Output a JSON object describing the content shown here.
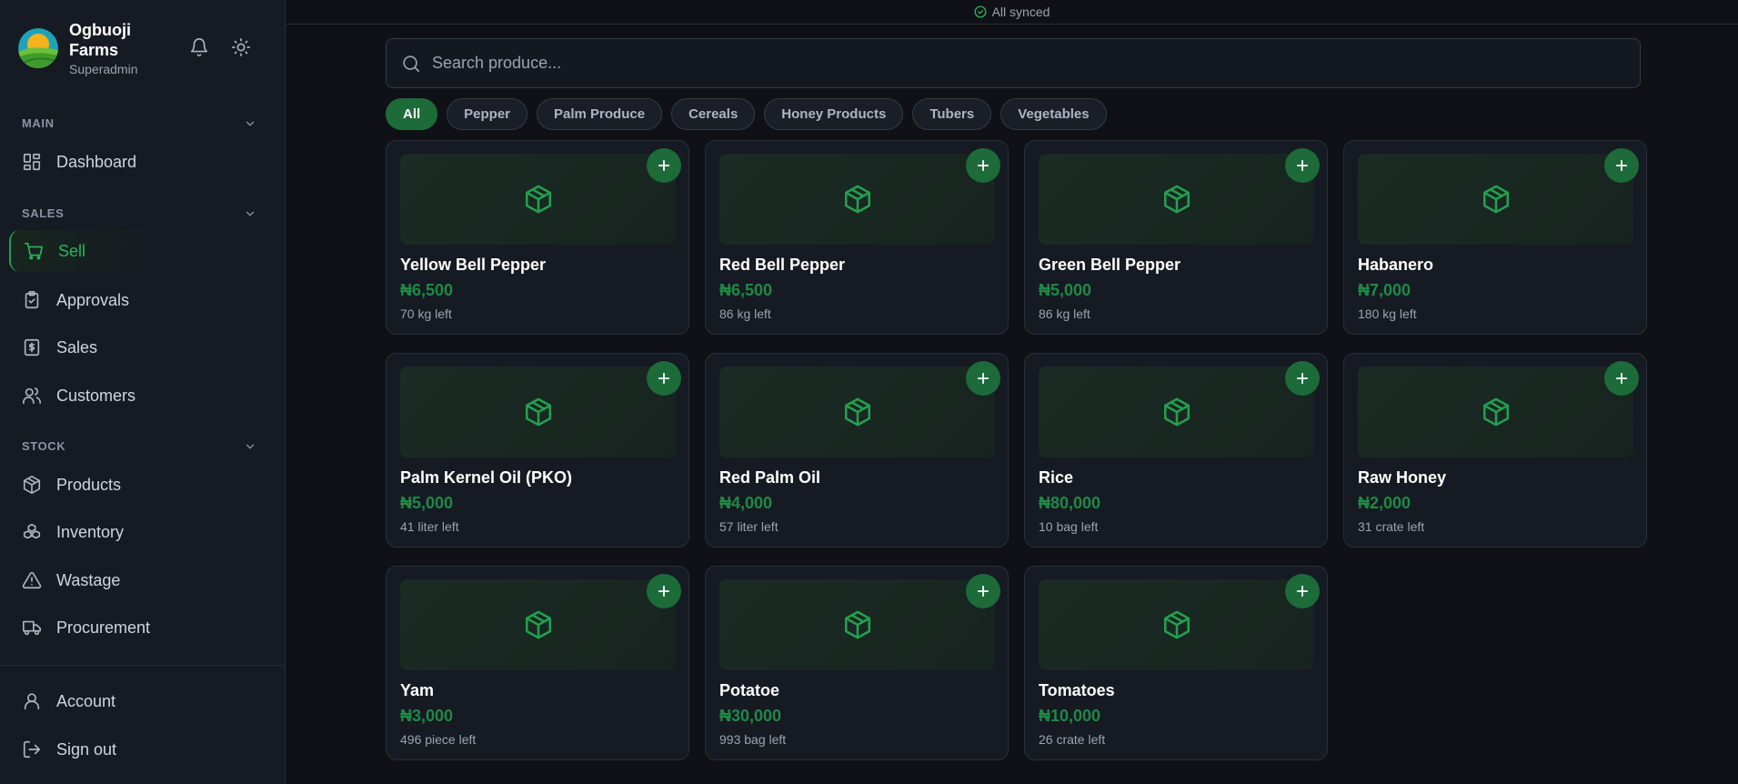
{
  "brand": {
    "name": "Ogbuoji Farms",
    "role": "Superadmin"
  },
  "icons": {
    "notifications": "bell-icon",
    "theme": "sun-icon"
  },
  "sidebar": {
    "sections": [
      {
        "label": "MAIN"
      },
      {
        "label": "SALES"
      },
      {
        "label": "STOCK"
      }
    ],
    "items": [
      {
        "label": "Dashboard",
        "icon": "dashboard-icon"
      },
      {
        "label": "Sell",
        "icon": "cart-icon",
        "active": true
      },
      {
        "label": "Approvals",
        "icon": "clipboard-check-icon"
      },
      {
        "label": "Sales",
        "icon": "receipt-dollar-icon"
      },
      {
        "label": "Customers",
        "icon": "users-icon"
      },
      {
        "label": "Products",
        "icon": "box-icon"
      },
      {
        "label": "Inventory",
        "icon": "boxes-icon"
      },
      {
        "label": "Wastage",
        "icon": "warning-icon"
      },
      {
        "label": "Procurement",
        "icon": "truck-icon"
      },
      {
        "label": "Account",
        "icon": "user-icon"
      },
      {
        "label": "Sign out",
        "icon": "sign-out-icon"
      }
    ]
  },
  "sync": {
    "status": "All synced"
  },
  "search": {
    "placeholder": "Search produce..."
  },
  "filters": [
    "All",
    "Pepper",
    "Palm Produce",
    "Cereals",
    "Honey Products",
    "Tubers",
    "Vegetables"
  ],
  "active_filter": "All",
  "products": [
    {
      "name": "Yellow Bell Pepper",
      "price": "₦6,500",
      "stock": "70 kg left"
    },
    {
      "name": "Red Bell Pepper",
      "price": "₦6,500",
      "stock": "86 kg left"
    },
    {
      "name": "Green Bell Pepper",
      "price": "₦5,000",
      "stock": "86 kg left"
    },
    {
      "name": "Habanero",
      "price": "₦7,000",
      "stock": "180 kg left"
    },
    {
      "name": "Palm Kernel Oil (PKO)",
      "price": "₦5,000",
      "stock": "41 liter left"
    },
    {
      "name": "Red Palm Oil",
      "price": "₦4,000",
      "stock": "57 liter left"
    },
    {
      "name": "Rice",
      "price": "₦80,000",
      "stock": "10 bag left"
    },
    {
      "name": "Raw Honey",
      "price": "₦2,000",
      "stock": "31 crate left"
    },
    {
      "name": "Yam",
      "price": "₦3,000",
      "stock": "496 piece left"
    },
    {
      "name": "Potatoe",
      "price": "₦30,000",
      "stock": "993 bag left"
    },
    {
      "name": "Tomatoes",
      "price": "₦10,000",
      "stock": "26 crate left"
    }
  ],
  "colors": {
    "accent": "#1c6b39",
    "accent_text": "#2bb55a",
    "price": "#1e8a45",
    "background": "#0f1117"
  }
}
